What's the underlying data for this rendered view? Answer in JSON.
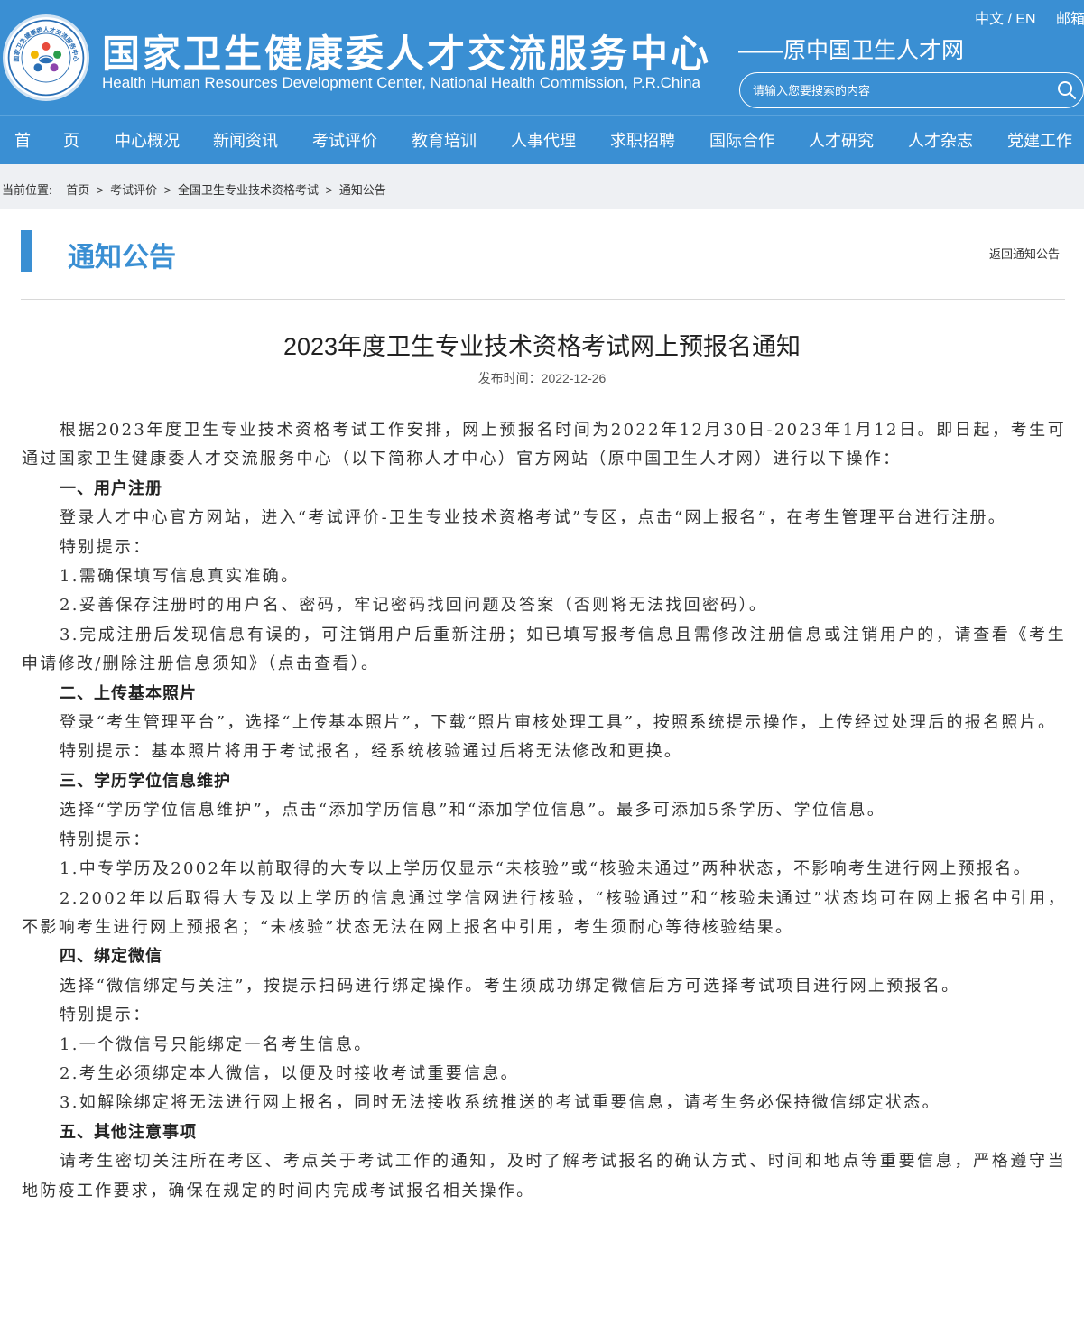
{
  "header": {
    "logo_text": "国家卫生健康委人才交流服务中心",
    "title": "国家卫生健康委人才交流服务中心",
    "subtitle_en": "Health Human Resources Development Center, National Health Commission, P.R.China",
    "former_name": "——原中国卫生人才网",
    "lang_switch": "中文 / EN",
    "mailbox": "邮箱",
    "search_placeholder": "请输入您要搜索的内容",
    "colors": {
      "primary": "#3a8fd3"
    }
  },
  "nav": {
    "items": [
      "首　　页",
      "中心概况",
      "新闻资讯",
      "考试评价",
      "教育培训",
      "人事代理",
      "求职招聘",
      "国际合作",
      "人才研究",
      "人才杂志",
      "党建工作"
    ]
  },
  "breadcrumb": {
    "label": "当前位置:",
    "items": [
      "首页",
      "考试评价",
      "全国卫生专业技术资格考试",
      "通知公告"
    ],
    "separator": ">"
  },
  "section": {
    "title": "通知公告",
    "back_link": "返回通知公告"
  },
  "article": {
    "title": "2023年度卫生专业技术资格考试网上预报名通知",
    "publish_date": "发布时间：2022-12-26",
    "paragraphs": [
      {
        "type": "text",
        "text": "根据2023年度卫生专业技术资格考试工作安排，网上预报名时间为2022年12月30日-2023年1月12日。即日起，考生可通过国家卫生健康委人才交流服务中心（以下简称人才中心）官方网站（原中国卫生人才网）进行以下操作："
      },
      {
        "type": "heading",
        "text": "一、用户注册"
      },
      {
        "type": "text",
        "text": "登录人才中心官方网站，进入“考试评价-卫生专业技术资格考试”专区，点击“网上报名”，在考生管理平台进行注册。"
      },
      {
        "type": "text",
        "text": "特别提示："
      },
      {
        "type": "text",
        "text": "1.需确保填写信息真实准确。"
      },
      {
        "type": "text",
        "text": "2.妥善保存注册时的用户名、密码，牢记密码找回问题及答案（否则将无法找回密码）。"
      },
      {
        "type": "text",
        "text": "3.完成注册后发现信息有误的，可注销用户后重新注册；如已填写报考信息且需修改注册信息或注销用户的，请查看《考生申请修改/删除注册信息须知》（点击查看）。"
      },
      {
        "type": "heading",
        "text": "二、上传基本照片"
      },
      {
        "type": "text",
        "text": "登录“考生管理平台”，选择“上传基本照片”，下载“照片审核处理工具”，按照系统提示操作，上传经过处理后的报名照片。"
      },
      {
        "type": "text",
        "text": "特别提示：基本照片将用于考试报名，经系统核验通过后将无法修改和更换。"
      },
      {
        "type": "heading",
        "text": "三、学历学位信息维护"
      },
      {
        "type": "text",
        "text": "选择“学历学位信息维护”，点击“添加学历信息”和“添加学位信息”。最多可添加5条学历、学位信息。"
      },
      {
        "type": "text",
        "text": "特别提示："
      },
      {
        "type": "text",
        "text": "1.中专学历及2002年以前取得的大专以上学历仅显示“未核验”或“核验未通过”两种状态，不影响考生进行网上预报名。"
      },
      {
        "type": "text",
        "text": "2.2002年以后取得大专及以上学历的信息通过学信网进行核验，“核验通过”和“核验未通过”状态均可在网上报名中引用，不影响考生进行网上预报名；“未核验”状态无法在网上报名中引用，考生须耐心等待核验结果。"
      },
      {
        "type": "heading",
        "text": "四、绑定微信"
      },
      {
        "type": "text",
        "text": "选择“微信绑定与关注”，按提示扫码进行绑定操作。考生须成功绑定微信后方可选择考试项目进行网上预报名。"
      },
      {
        "type": "text",
        "text": "特别提示："
      },
      {
        "type": "text",
        "text": "1.一个微信号只能绑定一名考生信息。"
      },
      {
        "type": "text",
        "text": "2.考生必须绑定本人微信，以便及时接收考试重要信息。"
      },
      {
        "type": "text",
        "text": "3.如解除绑定将无法进行网上报名，同时无法接收系统推送的考试重要信息，请考生务必保持微信绑定状态。"
      },
      {
        "type": "heading",
        "text": "五、其他注意事项"
      },
      {
        "type": "text",
        "text": "请考生密切关注所在考区、考点关于考试工作的通知，及时了解考试报名的确认方式、时间和地点等重要信息，严格遵守当地防疫工作要求，确保在规定的时间内完成考试报名相关操作。"
      }
    ]
  }
}
